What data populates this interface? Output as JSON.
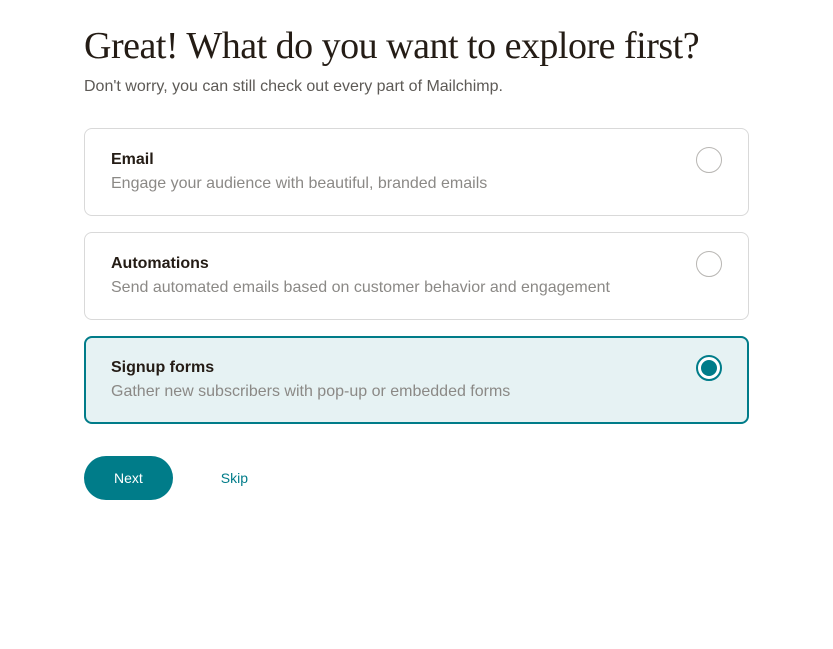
{
  "heading": "Great! What do you want to explore first?",
  "subheading": "Don't worry, you can still check out every part of Mailchimp.",
  "options": [
    {
      "title": "Email",
      "description": "Engage your audience with beautiful, branded emails",
      "selected": false
    },
    {
      "title": "Automations",
      "description": "Send automated emails based on customer behavior and engagement",
      "selected": false
    },
    {
      "title": "Signup forms",
      "description": "Gather new subscribers with pop-up or embedded forms",
      "selected": true
    }
  ],
  "actions": {
    "next": "Next",
    "skip": "Skip"
  },
  "colors": {
    "accent": "#007c89",
    "selectedBg": "#e6f2f3"
  }
}
